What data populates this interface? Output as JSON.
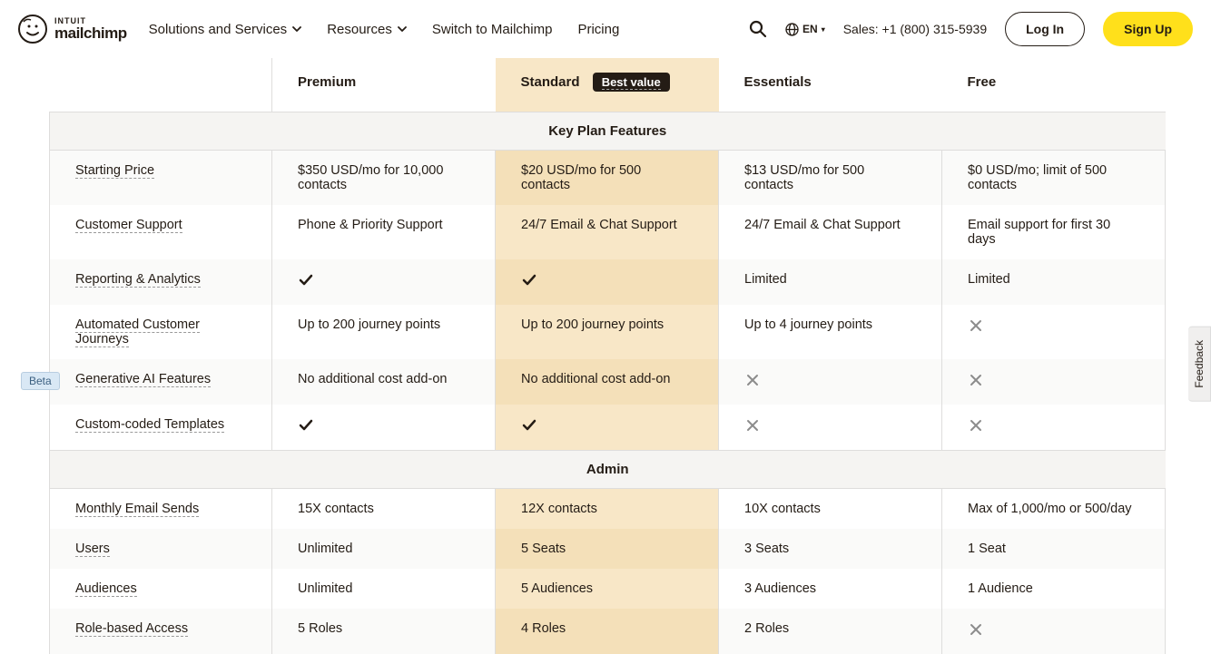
{
  "header": {
    "brand_top": "INTUIT",
    "brand_bottom": "mailchimp",
    "nav": {
      "solutions": "Solutions and Services",
      "resources": "Resources",
      "switch": "Switch to Mailchimp",
      "pricing": "Pricing"
    },
    "lang": "EN",
    "sales": "Sales: +1 (800) 315-5939",
    "login": "Log In",
    "signup": "Sign Up"
  },
  "plans": {
    "premium": "Premium",
    "standard": "Standard",
    "best_value": "Best value",
    "essentials": "Essentials",
    "free": "Free"
  },
  "sections": {
    "key": "Key Plan Features",
    "admin": "Admin"
  },
  "beta_label": "Beta",
  "rows": {
    "starting_price": {
      "label": "Starting Price",
      "premium": "$350 USD/mo for 10,000 contacts",
      "standard": "$20 USD/mo for 500 contacts",
      "essentials": "$13 USD/mo for 500 contacts",
      "free": "$0 USD/mo; limit of 500 contacts"
    },
    "support": {
      "label": "Customer Support",
      "premium": "Phone & Priority Support",
      "standard": "24/7 Email & Chat Support",
      "essentials": "24/7 Email & Chat Support",
      "free": "Email support for first 30 days"
    },
    "reporting": {
      "label": "Reporting & Analytics",
      "essentials": "Limited",
      "free": "Limited"
    },
    "journeys": {
      "label": "Automated Customer Journeys",
      "premium": "Up to 200 journey points",
      "standard": "Up to 200 journey points",
      "essentials": "Up to 4 journey points"
    },
    "genai": {
      "label": "Generative AI Features",
      "premium": "No additional cost add-on",
      "standard": "No additional cost add-on"
    },
    "templates": {
      "label": "Custom-coded Templates"
    },
    "sends": {
      "label": "Monthly Email Sends",
      "premium": "15X contacts",
      "standard": "12X contacts",
      "essentials": "10X contacts",
      "free": "Max of 1,000/mo or 500/day"
    },
    "users": {
      "label": "Users",
      "premium": "Unlimited",
      "standard": "5 Seats",
      "essentials": "3 Seats",
      "free": "1 Seat"
    },
    "audiences": {
      "label": "Audiences",
      "premium": "Unlimited",
      "standard": "5 Audiences",
      "essentials": "3 Audiences",
      "free": "1 Audience"
    },
    "roles": {
      "label": "Role-based Access",
      "premium": "5 Roles",
      "standard": "4 Roles",
      "essentials": "2 Roles"
    }
  },
  "feedback": "Feedback"
}
